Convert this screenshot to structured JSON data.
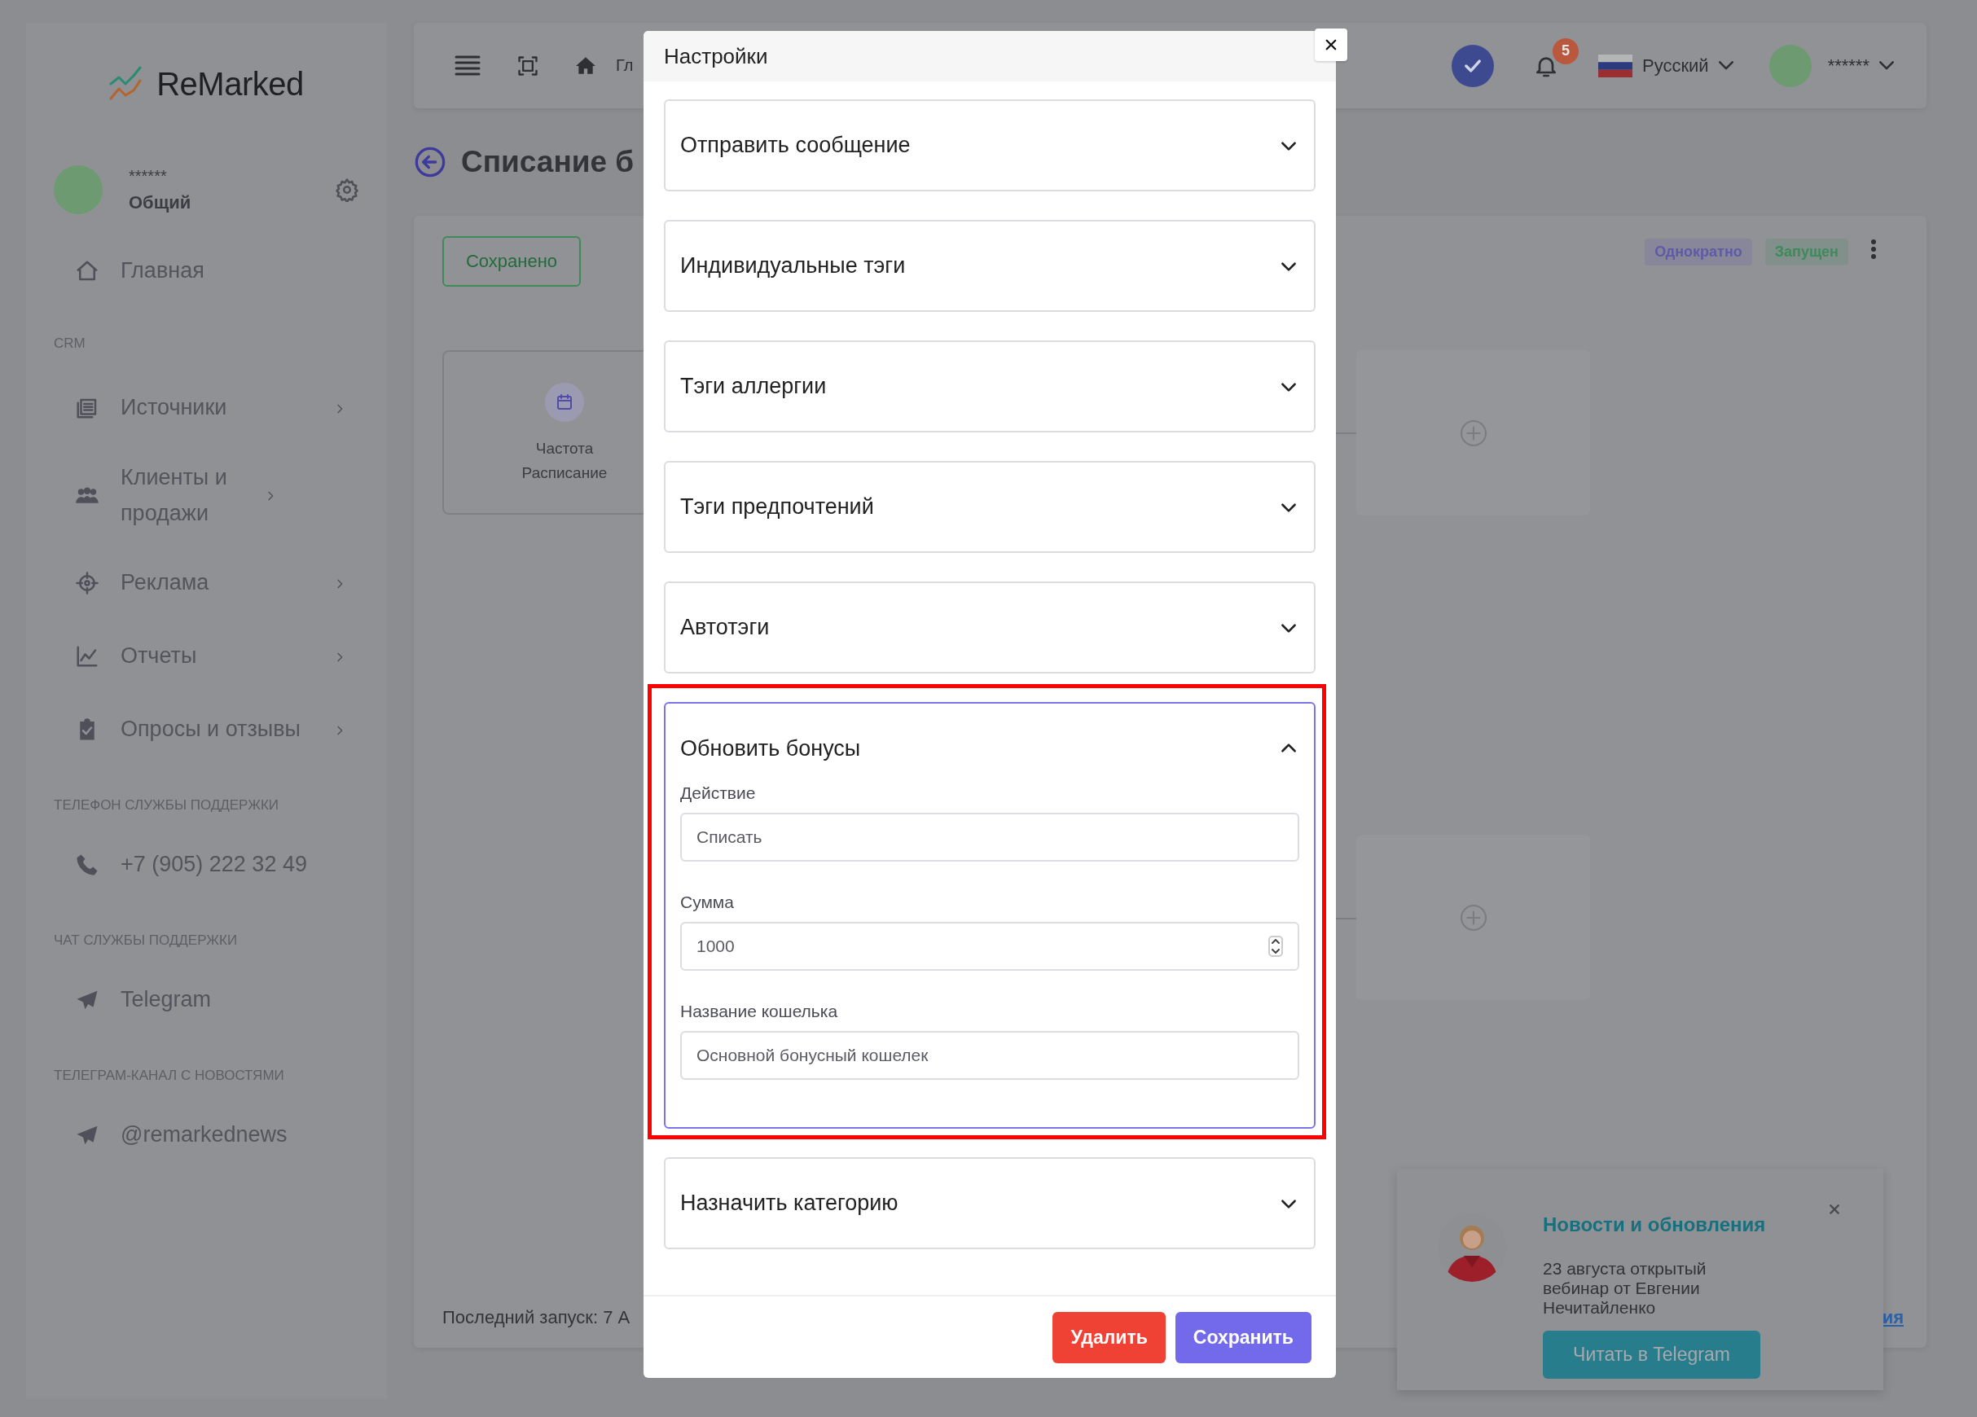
{
  "sidebar": {
    "logo": "ReMarked",
    "user_name": "******",
    "user_role": "Общий",
    "items": [
      {
        "kind": "link",
        "label": "Главная"
      },
      {
        "kind": "heading",
        "label": "CRM"
      },
      {
        "kind": "submenu",
        "label": "Источники"
      },
      {
        "kind": "submenu",
        "label": "Клиенты и продажи"
      },
      {
        "kind": "submenu",
        "label": "Реклама"
      },
      {
        "kind": "submenu",
        "label": "Отчеты"
      },
      {
        "kind": "submenu",
        "label": "Опросы и отзывы"
      },
      {
        "kind": "heading",
        "label": "ТЕЛЕФОН СЛУЖБЫ ПОДДЕРЖКИ"
      },
      {
        "kind": "link",
        "label": "+7 (905) 222 32 49"
      },
      {
        "kind": "heading",
        "label": "ЧАТ СЛУЖБЫ ПОДДЕРЖКИ"
      },
      {
        "kind": "link",
        "label": "Telegram"
      },
      {
        "kind": "heading",
        "label": "ТЕЛЕГРАМ-КАНАЛ С НОВОСТЯМИ"
      },
      {
        "kind": "link",
        "label": "@remarkednews"
      }
    ]
  },
  "topbar": {
    "breadcrumb": "Гл",
    "notifications": "5",
    "language": "Русский",
    "user_name": "******"
  },
  "page": {
    "title": "Списание б",
    "status_button": "Сохранено",
    "badges": [
      {
        "label": "Однократно",
        "color": "#5f5aa8"
      },
      {
        "label": "Запущен",
        "color": "#3d8a5a"
      }
    ],
    "node_lines": [
      "Частота",
      "Расписание"
    ],
    "last_run": "Последний запуск: 7 А",
    "link_fragment": "ия"
  },
  "modal": {
    "title": "Настройки",
    "sections": [
      {
        "title": "Отправить сообщение",
        "expanded": false,
        "highlighted": false
      },
      {
        "title": "Индивидуальные тэги",
        "expanded": false,
        "highlighted": false
      },
      {
        "title": "Тэги аллергии",
        "expanded": false,
        "highlighted": false
      },
      {
        "title": "Тэги предпочтений",
        "expanded": false,
        "highlighted": false
      },
      {
        "title": "Автотэги",
        "expanded": false,
        "highlighted": false
      },
      {
        "title": "Обновить бонусы",
        "expanded": true,
        "highlighted": true,
        "fields": [
          {
            "label": "Действие",
            "value": "Списать",
            "kind": "text"
          },
          {
            "label": "Сумма",
            "value": "1000",
            "kind": "number"
          },
          {
            "label": "Название кошелька",
            "value": "Основной бонусный кошелек",
            "kind": "text"
          }
        ]
      },
      {
        "title": "Назначить категорию",
        "expanded": false,
        "highlighted": false
      }
    ],
    "buttons": [
      {
        "label": "Удалить",
        "kind": "danger"
      },
      {
        "label": "Сохранить",
        "kind": "primary"
      }
    ]
  },
  "popup": {
    "title": "Новости и обновления",
    "text": "23 августа открытый вебинар от Евгении Нечитайленко",
    "button": "Читать в Telegram"
  }
}
